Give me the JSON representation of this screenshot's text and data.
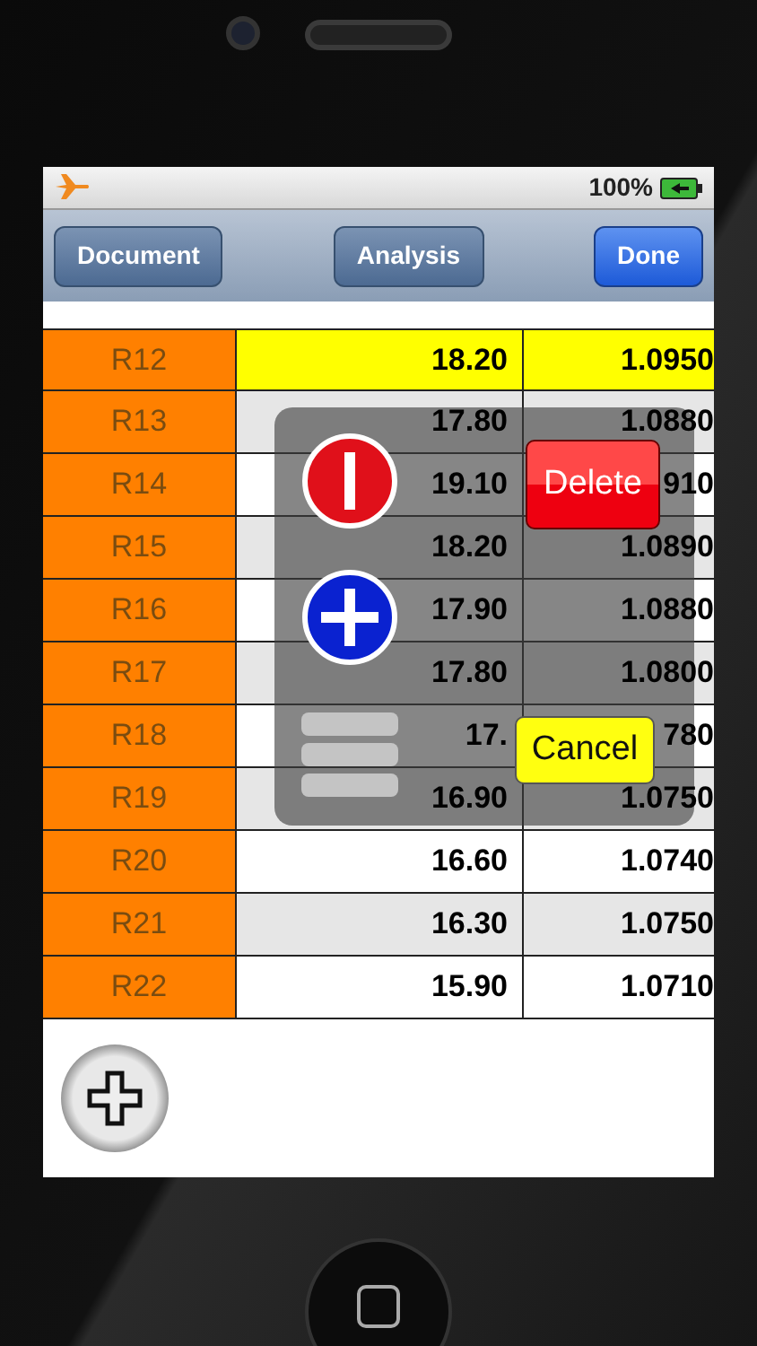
{
  "status_bar": {
    "airplane_mode": true,
    "battery": "100%",
    "charging": true
  },
  "toolbar": {
    "buttons": [
      {
        "label": "Document",
        "kind": "plain"
      },
      {
        "label": "Analysis",
        "kind": "plain"
      },
      {
        "label": "Done",
        "kind": "primary"
      }
    ]
  },
  "table": {
    "rows": [
      {
        "label": "R12",
        "selected": true,
        "column_2": "18.20",
        "column_3": "1.0950"
      },
      {
        "label": "R13",
        "selected": false,
        "column_2": "17.80",
        "column_3": "1.0880"
      },
      {
        "label": "R14",
        "selected": false,
        "column_2": "19.10",
        "column_3": "910"
      },
      {
        "label": "R15",
        "selected": false,
        "column_2": "18.20",
        "column_3": "1.0890"
      },
      {
        "label": "R16",
        "selected": false,
        "column_2": "17.90",
        "column_3": "1.0880"
      },
      {
        "label": "R17",
        "selected": false,
        "column_2": "17.80",
        "column_3": "1.0800"
      },
      {
        "label": "R18",
        "selected": false,
        "column_2": "17.",
        "column_3": "780"
      },
      {
        "label": "R19",
        "selected": false,
        "column_2": "16.90",
        "column_3": "1.0750"
      },
      {
        "label": "R20",
        "selected": false,
        "column_2": "16.60",
        "column_3": "1.0740"
      },
      {
        "label": "R21",
        "selected": false,
        "column_2": "16.30",
        "column_3": "1.0750"
      },
      {
        "label": "R22",
        "selected": false,
        "column_2": "15.90",
        "column_3": "1.0710"
      }
    ]
  },
  "row_menu": {
    "buttons": [
      {
        "label": "Delete",
        "kind": "destructive"
      },
      {
        "label": "Cancel",
        "kind": "cancel"
      }
    ]
  }
}
